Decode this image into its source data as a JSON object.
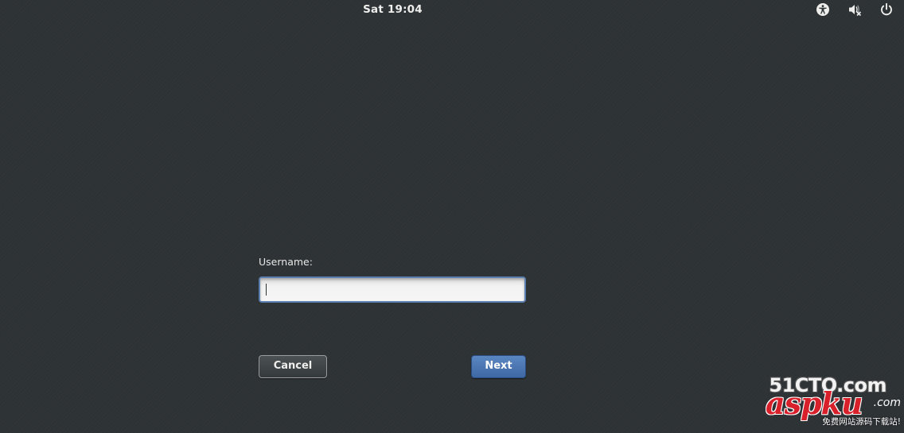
{
  "top_bar": {
    "clock": "Sat 19:04",
    "status_icons": [
      "accessibility-icon",
      "volume-muted-icon",
      "power-icon"
    ]
  },
  "login": {
    "prompt_label": "Username:",
    "username_value": "",
    "cancel_label": "Cancel",
    "next_label": "Next"
  },
  "colors": {
    "background": "#2e3336",
    "entry_focus_border": "#5b7fb0",
    "next_button": "#4a75b2",
    "cancel_button": "#3f4446"
  },
  "watermark": {
    "site1": "51CTO.com",
    "site2": "aspku",
    "site2_suffix": ".com",
    "slogan": "免费网站源码下载站!"
  }
}
